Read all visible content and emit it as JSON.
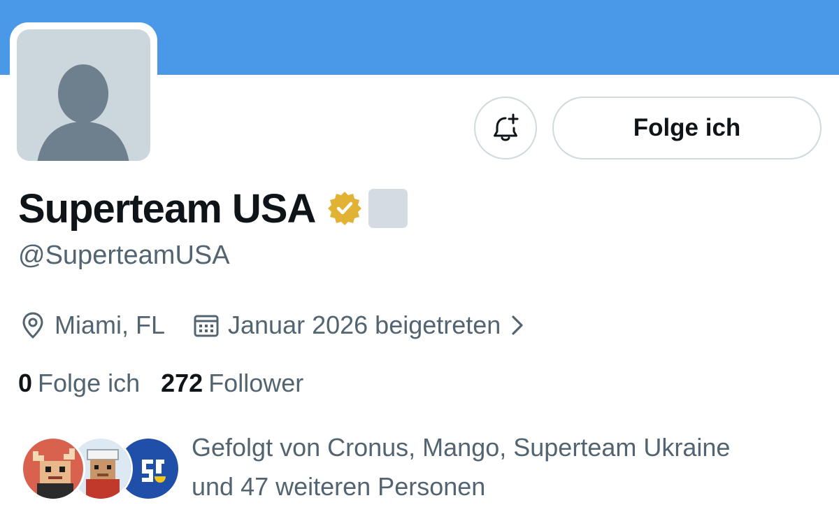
{
  "profile": {
    "display_name": "Superteam USA",
    "handle": "@SuperteamUSA",
    "location": "Miami, FL",
    "joined": "Januar 2026 beigetreten"
  },
  "actions": {
    "follow_label": "Folge ich"
  },
  "stats": {
    "following_count": "0",
    "following_label": "Folge ich",
    "followers_count": "272",
    "followers_label": "Follower"
  },
  "followed_by": {
    "line1": "Gefolgt von Cronus, Mango, Superteam Ukraine",
    "line2": "und 47 weiteren Personen"
  },
  "colors": {
    "banner": "#4a99e9",
    "verified_gold": "#e2b234",
    "secondary_text": "#536471",
    "primary_text": "#0f1419"
  },
  "icons": {
    "notify": "bell-plus-icon",
    "verified": "verified-gold-badge-icon",
    "location": "location-pin-icon",
    "calendar": "calendar-icon",
    "chevron": "chevron-right-icon"
  }
}
